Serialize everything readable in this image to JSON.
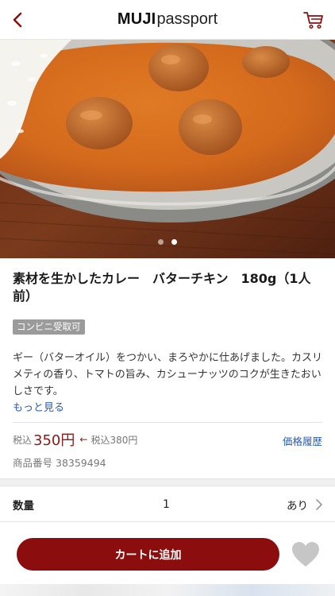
{
  "header": {
    "logo_bold": "MUJI",
    "logo_light": "passport",
    "back_icon": "chevron-left-icon",
    "cart_icon": "cart-icon"
  },
  "hero": {
    "image_count": 2,
    "active_index": 1
  },
  "product": {
    "title": "素材を生かしたカレー　バターチキン　180g（1人前）",
    "badge": "コンビニ受取可",
    "description": "ギー（バターオイル）をつかい、まろやかに仕あげました。カスリメティの香り、トマトの旨み、カシューナッツのコクが生きたおいしさです。",
    "more_link": "もっと見る",
    "tax_label": "税込",
    "price": "350円",
    "price_arrow": "←",
    "old_tax_label": "税込",
    "old_price": "380円",
    "price_history": "価格履歴",
    "item_number_label": "商品番号",
    "item_number": "38359494"
  },
  "quantity": {
    "label": "数量",
    "value": "1",
    "stock": "あり"
  },
  "actions": {
    "add_to_cart": "カートに追加",
    "favorite_icon": "heart-icon"
  },
  "colors": {
    "accent": "#8b0d0d",
    "link": "#2a5db0",
    "badge_bg": "#9b9b9b"
  }
}
